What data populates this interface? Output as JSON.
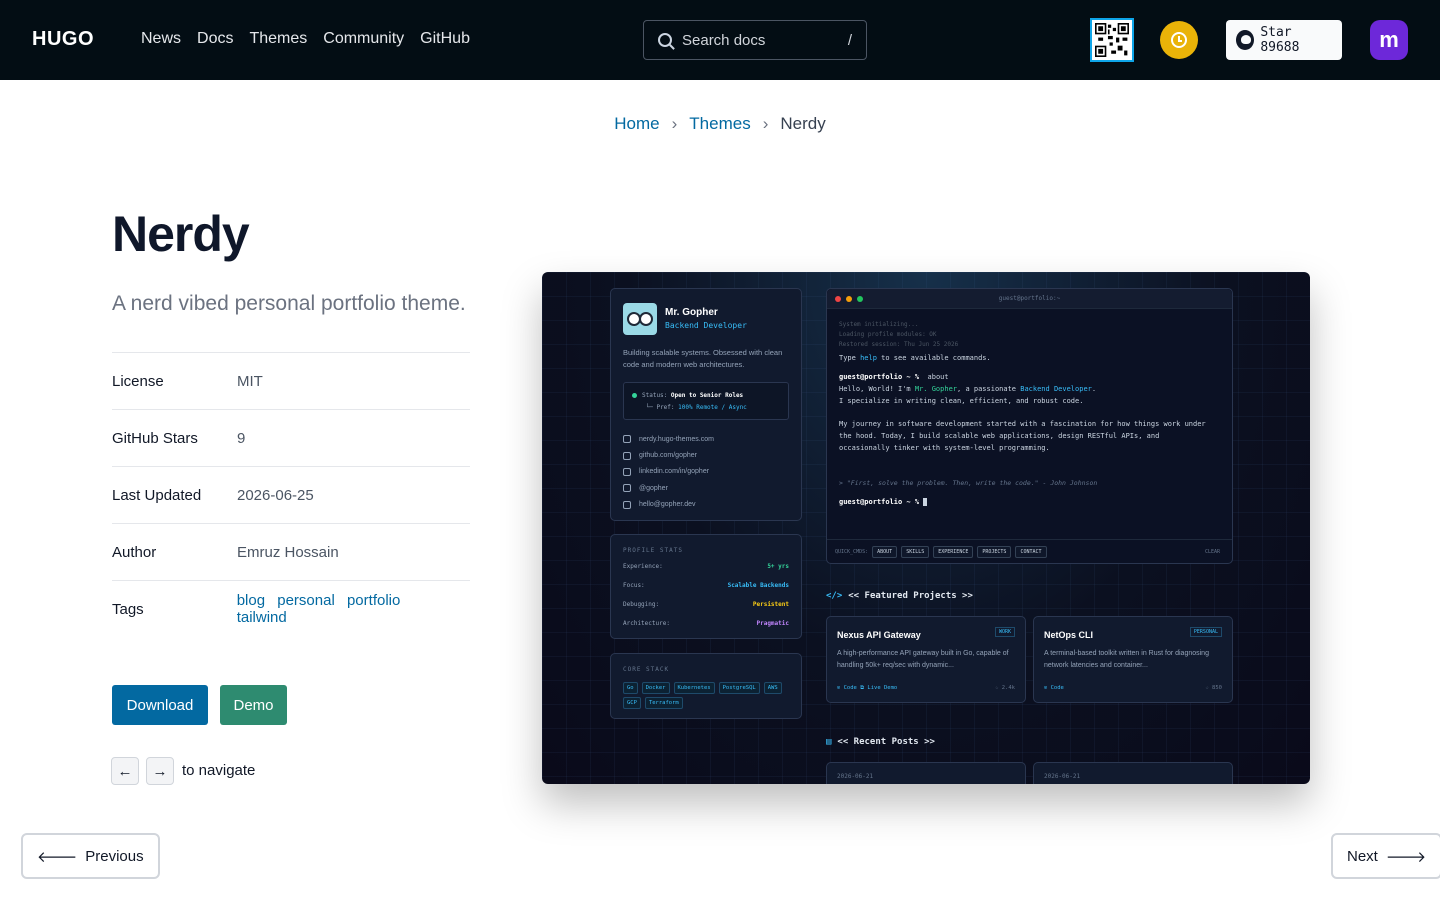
{
  "header": {
    "logo": "HUGO",
    "nav": [
      "News",
      "Docs",
      "Themes",
      "Community",
      "GitHub"
    ],
    "search_placeholder": "Search docs",
    "search_shortcut": "/",
    "star_label": "Star 89688",
    "mastodon_glyph": "m"
  },
  "breadcrumb": {
    "home": "Home",
    "themes": "Themes",
    "current": "Nerdy",
    "separator": "›"
  },
  "theme": {
    "title": "Nerdy",
    "description": "A nerd vibed personal portfolio theme.",
    "meta": [
      {
        "key": "License",
        "value": "MIT"
      },
      {
        "key": "GitHub Stars",
        "value": "9"
      },
      {
        "key": "Last Updated",
        "value": "2026-06-25"
      },
      {
        "key": "Author",
        "value": "Emruz Hossain"
      }
    ],
    "tags_label": "Tags",
    "tags": [
      "blog",
      "personal",
      "portfolio",
      "tailwind"
    ],
    "download_label": "Download",
    "demo_label": "Demo",
    "key_left": "←",
    "key_right": "→",
    "nav_hint": "to navigate"
  },
  "pager": {
    "prev": "Previous",
    "next": "Next",
    "prev_arrow": "🡐",
    "next_arrow": "🡒"
  },
  "preview": {
    "name": "Mr. Gopher",
    "role": "Backend Developer",
    "bio": "Building scalable systems. Obsessed with clean code and modern web architectures.",
    "status_label": "Status:",
    "status_value": "Open to Senior Roles",
    "pref_label": "└─ Pref:",
    "pref_value": "100% Remote / Async",
    "links": [
      "nerdy.hugo-themes.com",
      "github.com/gopher",
      "linkedin.com/in/gopher",
      "@gopher",
      "hello@gopher.dev"
    ],
    "stats_title": "PROFILE STATS",
    "stats": [
      {
        "k": "Experience:",
        "v": "5+ yrs",
        "color": "#34d399"
      },
      {
        "k": "Focus:",
        "v": "Scalable Backends",
        "color": "#38bdf8"
      },
      {
        "k": "Debugging:",
        "v": "Persistent",
        "color": "#facc15"
      },
      {
        "k": "Architecture:",
        "v": "Pragmatic",
        "color": "#c084fc"
      }
    ],
    "stack_title": "CORE STACK",
    "stack": [
      "Go",
      "Docker",
      "Kubernetes",
      "PostgreSQL",
      "AWS",
      "GCP",
      "Terraform"
    ],
    "term_title": "guest@portfolio:~",
    "term_dim": [
      "System initializing...",
      "Loading profile modules: OK",
      "Restored session: Thu Jun 25 2026"
    ],
    "term_help_pre": "Type ",
    "term_help_cmd": "help",
    "term_help_post": " to see available commands.",
    "prompt": "guest@portfolio ~ %",
    "cmd": "about",
    "about_1_pre": "Hello, World! I'm ",
    "about_1_name": "Mr. Gopher",
    "about_1_mid": ", a passionate ",
    "about_1_role": "Backend Developer",
    "about_1_end": ".",
    "about_2": "I specialize in writing clean, efficient, and robust code.",
    "about_3": "My journey in software development started with a fascination for how things work under",
    "about_4": "the hood. Today, I build scalable web applications, design RESTful APIs, and",
    "about_5": "occasionally tinker with system-level programming.",
    "quote": "> \"First, solve the problem. Then, write the code.\" - John Johnson",
    "quick_label": "QUICK_CMDS:",
    "quick": [
      "ABOUT",
      "SKILLS",
      "EXPERIENCE",
      "PROJECTS",
      "CONTACT"
    ],
    "clear": "CLEAR",
    "projects_title": "<< Featured Projects >>",
    "projects": [
      {
        "name": "Nexus API Gateway",
        "badge": "WORK",
        "desc": "A high-performance API gateway built in Go, capable of handling 50k+ req/sec with dynamic...",
        "links": "⊙ Code   ⧉ Live Demo",
        "stars": "☆ 2.4k"
      },
      {
        "name": "NetOps CLI",
        "badge": "PERSONAL",
        "desc": "A terminal-based toolkit written in Rust for diagnosing network latencies and container...",
        "links": "⊙ Code",
        "stars": "☆ 850"
      }
    ],
    "posts_title": "<< Recent Posts >>",
    "posts": [
      "2026-06-21",
      "2026-06-21"
    ]
  }
}
